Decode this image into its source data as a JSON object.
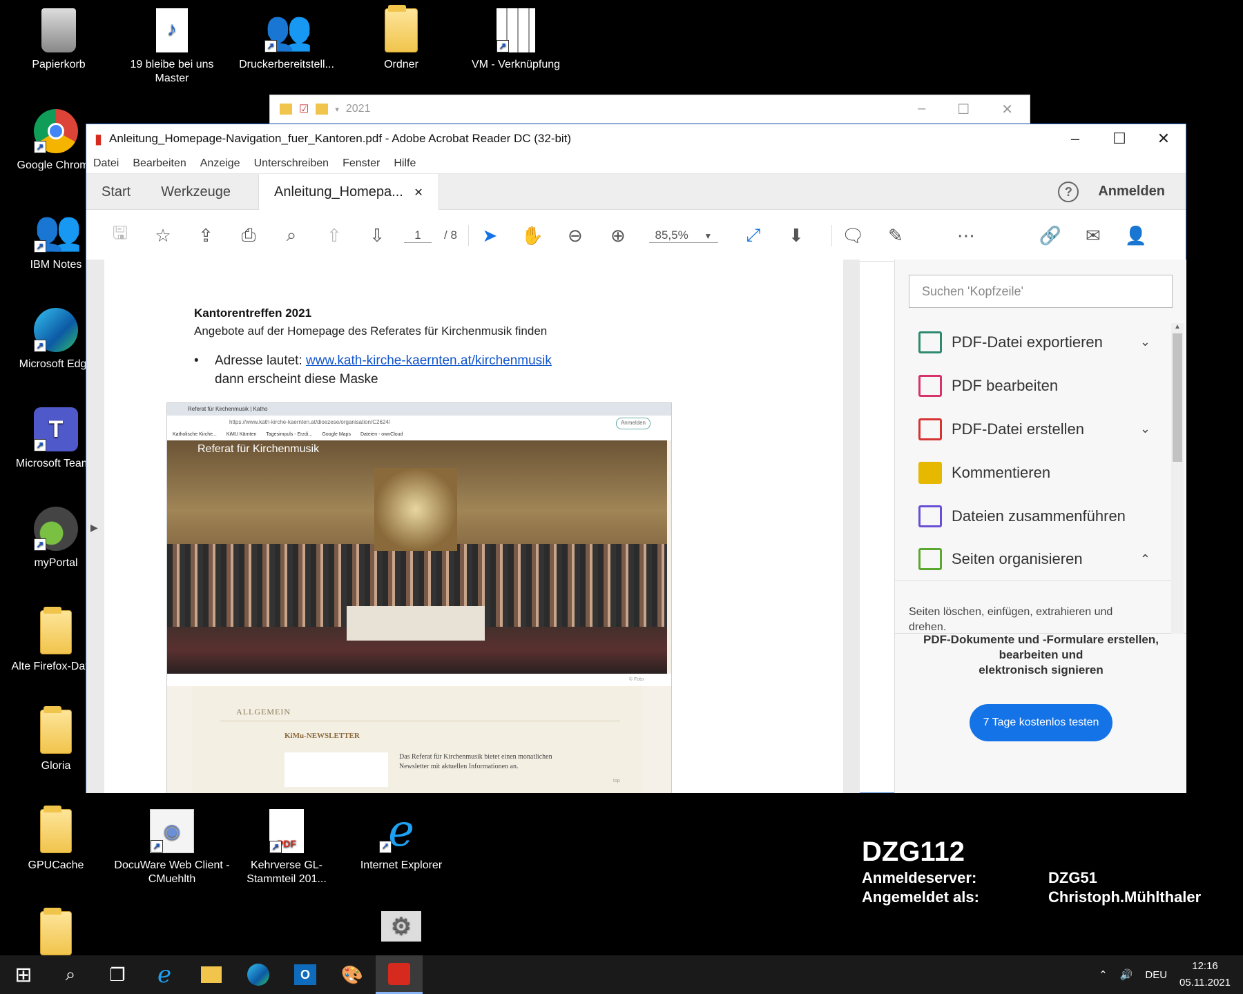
{
  "desktop": {
    "icons": [
      {
        "label": "Papierkorb",
        "icon": "recycle-bin-icon"
      },
      {
        "label": "19 bleibe bei uns Master",
        "icon": "mp3-file-icon"
      },
      {
        "label": "Druckerbereitstell...",
        "icon": "people-icon"
      },
      {
        "label": "Ordner",
        "icon": "zip-folder-icon"
      },
      {
        "label": "VM - Verknüpfung",
        "icon": "vm-icon"
      },
      {
        "label": "Google Chrome",
        "icon": "chrome-icon"
      },
      {
        "label": "IBM Notes",
        "icon": "ibm-notes-icon"
      },
      {
        "label": "Microsoft Edge",
        "icon": "edge-icon"
      },
      {
        "label": "Microsoft Teams",
        "icon": "teams-icon"
      },
      {
        "label": "myPortal",
        "icon": "myportal-icon"
      },
      {
        "label": "Alte Firefox-Daten",
        "icon": "folder-icon"
      },
      {
        "label": "Gloria",
        "icon": "pdf-folder-icon"
      },
      {
        "label": "GPUCache",
        "icon": "folder-icon"
      },
      {
        "label": "DocuWare Web Client - CMuehlth",
        "icon": "docuware-icon"
      },
      {
        "label": "Kehrverse GL-Stammteil 201...",
        "icon": "pdf-file-icon"
      },
      {
        "label": "Internet Explorer",
        "icon": "ie-icon"
      }
    ]
  },
  "background_window": {
    "title": "2021"
  },
  "acrobat": {
    "title": "Anleitung_Homepage-Navigation_fuer_Kantoren.pdf - Adobe Acrobat Reader DC (32-bit)",
    "menu": [
      "Datei",
      "Bearbeiten",
      "Anzeige",
      "Unterschreiben",
      "Fenster",
      "Hilfe"
    ],
    "tabs": {
      "start": "Start",
      "tools": "Werkzeuge",
      "doc": "Anleitung_Homepa..."
    },
    "signin": "Anmelden",
    "page_current": "1",
    "page_total": "/ 8",
    "zoom": "85,5%",
    "document": {
      "heading": "Kantorentreffen 2021",
      "subheading": "Angebote auf der Homepage des Referates für Kirchenmusik finden",
      "bullet_prefix": "Adresse lautet: ",
      "link": "www.kath-kirche-kaernten.at/kirchenmusik",
      "bullet_cont": "dann erscheint diese Maske",
      "screenshot": {
        "tab": "Referat für Kirchenmusik | Katho",
        "url": "https://www.kath-kirche-kaernten.at/dioezese/organisation/C2624/",
        "signin": "Anmelden",
        "bookmarks": [
          "Katholische Kirche...",
          "KiMU Kärnten",
          "Tagesimpuls - Erzdi...",
          "Google Maps",
          "Dateien - ownCloud"
        ],
        "hero": "Referat für Kirchenmusik",
        "credit": "© Foto",
        "section": "ALLGEMEIN",
        "newsletter_title": "KiMu-NEWSLETTER",
        "newsletter_text": "Das Referat für Kirchenmusik bietet einen monatlichen Newsletter mit aktuellen Informationen an.",
        "top": "top"
      }
    },
    "panel": {
      "search_placeholder": "Suchen 'Kopfzeile'",
      "tools": [
        {
          "label": "PDF-Datei exportieren",
          "color": "#2d8a6e"
        },
        {
          "label": "PDF bearbeiten",
          "color": "#d6336c"
        },
        {
          "label": "PDF-Datei erstellen",
          "color": "#d63333"
        },
        {
          "label": "Kommentieren",
          "color": "#e6b800"
        },
        {
          "label": "Dateien zusammenführen",
          "color": "#6a4fd6"
        },
        {
          "label": "Seiten organisieren",
          "color": "#5aa832"
        }
      ],
      "tool_desc": "Seiten löschen, einfügen, extrahieren und drehen.",
      "promo_line1": "PDF-Dokumente und -Formulare erstellen,",
      "promo_line2": "bearbeiten und",
      "promo_line3": "elektronisch signieren",
      "try_button": "7 Tage kostenlos testen"
    }
  },
  "bginfo": {
    "host": "DZG112",
    "server_label": "Anmeldeserver:",
    "server_value": "DZG51",
    "user_label": "Angemeldet als:",
    "user_value": "Christoph.Mühlthaler"
  },
  "taskbar": {
    "lang": "DEU",
    "time": "12:16",
    "date": "05.11.2021"
  }
}
